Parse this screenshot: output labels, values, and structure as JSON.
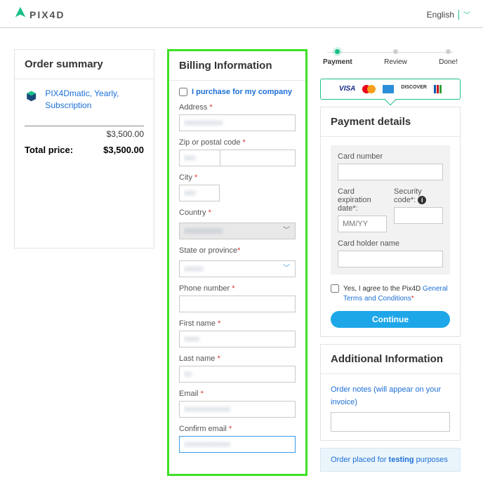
{
  "header": {
    "brand": "PIX4D",
    "language": "English"
  },
  "progress": {
    "steps": [
      "Payment",
      "Review",
      "Done!"
    ],
    "activeIndex": 0
  },
  "payment_logos": [
    "VISA"
  ],
  "order_summary": {
    "title": "Order summary",
    "item_name": "PIX4Dmatic, Yearly, Subscription",
    "item_price": "$3,500.00",
    "total_label": "Total price:",
    "total_value": "$3,500.00"
  },
  "billing": {
    "title": "Billing Information",
    "company_purchase": "I purchase for my company",
    "address_label": "Address",
    "zip_label": "Zip or postal code",
    "city_label": "City",
    "country_label": "Country",
    "state_label": "State or province",
    "phone_label": "Phone number",
    "first_label": "First name",
    "last_label": "Last name",
    "email_label": "Email",
    "confirm_email_label": "Confirm email"
  },
  "payment_details": {
    "title": "Payment details",
    "card_number_label": "Card number",
    "exp_label": "Card expiration date*:",
    "exp_placeholder": "MM/YY",
    "cvc_label": "Security code*:",
    "holder_label": "Card holder name",
    "terms_prefix": "Yes, I agree to the Pix4D ",
    "terms_link": "General Terms and Conditions",
    "continue_label": "Continue"
  },
  "additional": {
    "title": "Additional Information",
    "notes_label": "Order notes (will appear on your invoice)"
  },
  "testing_banner": {
    "prefix": "Order placed for ",
    "bold": "testing",
    "suffix": " purposes"
  }
}
